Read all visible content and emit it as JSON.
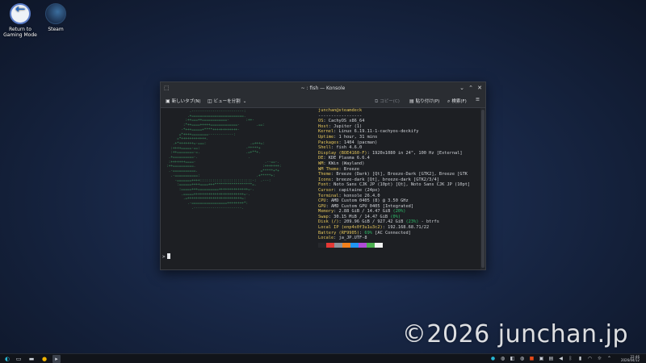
{
  "desktop": {
    "icons": [
      {
        "label": "Return to Gaming Mode"
      },
      {
        "label": "Steam"
      }
    ]
  },
  "window": {
    "title": "~ : fish — Konsole",
    "toolbar": {
      "new_tab": "新しいタブ(N)",
      "split_view": "ビューを分割",
      "copy": "コピー(C)",
      "paste": "貼り付け(P)",
      "find": "検索(F)"
    }
  },
  "terminal": {
    "ascii_art": [
      "             .-------------------------:",
      "            .+=========================.",
      "           :++===++============-        :++-",
      "          :*++====+++++=============-        .==:",
      "         -*+++=====+****++++++++++++-",
      "        =*++++========------------:",
      "       =*++++++++++++.",
      "     .+*+++++++=-===:                     .=+++=:",
      "    :++++=====-==:                      -*****+",
      "    :++========-=.                      .=+**+.",
      "   .+==========-.                        .",
      "   :+++++++====-                                 .--==-.",
      "  :++==========.                                :+++++++:",
      "   .-===========.                              =*****+*+",
      "    .-===========:                           .+*****+:",
      "      -=======++++:::::::::::::::::::::::::-:  .---:",
      "       :======++++====+++******************=.",
      "        :=====+++==========++++++++++++++=-.",
      "         .=====++++++++++++++++++++++++=-.",
      "          .=++++++++++++++++++++++++++=:",
      "            .-=================++++++++*:",
      "              .-----------------------."
    ],
    "header": "junchan@steamdeck",
    "separator": "-----------------",
    "info": [
      {
        "k": "OS",
        "v": "CachyOS x86_64"
      },
      {
        "k": "Host",
        "v": "Jupiter (1)"
      },
      {
        "k": "Kernel",
        "v": "Linux 6.19.11-1-cachyos-deckify"
      },
      {
        "k": "Uptime",
        "v": "1 hour, 31 mins"
      },
      {
        "k": "Packages",
        "v": "1404 (pacman)"
      },
      {
        "k": "Shell",
        "v": "fish 4.6.0"
      },
      {
        "k": "Display (BOE4160-F)",
        "v": "1920x1080 in 24\", 100 Hz [External]"
      },
      {
        "k": "DE",
        "v": "KDE Plasma 6.6.4"
      },
      {
        "k": "WM",
        "v": "KWin (Wayland)"
      },
      {
        "k": "WM Theme",
        "v": "Breeze"
      },
      {
        "k": "Theme",
        "v": "Breeze (Dark) [Qt], Breeze-Dark [GTK2], Breeze [GTK"
      },
      {
        "k": "Icons",
        "v": "breeze-dark [Qt], breeze-dark [GTK2/3/4]"
      },
      {
        "k": "Font",
        "v": "Noto Sans CJK JP (10pt) [Qt], Noto Sans CJK JP (10pt]"
      },
      {
        "k": "Cursor",
        "v": "capitaine (24px)"
      },
      {
        "k": "Terminal",
        "v": "konsole 26.4.0"
      },
      {
        "k": "CPU",
        "v": "AMD Custom 0405 (8) @ 3.50 GHz"
      },
      {
        "k": "GPU",
        "v": "AMD Custom GPU 0405 [Integrated]"
      },
      {
        "k": "Memory",
        "v": "2.88 GiB / 14.47 GiB",
        "pct": "(20%)"
      },
      {
        "k": "Swap",
        "v": "30.15 MiB / 14.47 GiB",
        "pct": "(0%)"
      },
      {
        "k": "Disk (/)",
        "v": "209.96 GiB / 927.42 GiB",
        "pct": "(23%)",
        "tail": " - btrfs"
      },
      {
        "k": "Local IP (enp4s0f3u1u3c2)",
        "v": "192.168.68.71/22"
      },
      {
        "k": "Battery (RF9905)",
        "v": "",
        "pct": "69%",
        "tail": " [AC Connected]"
      },
      {
        "k": "Locale",
        "v": "ja_JP.UTF-8"
      }
    ],
    "palette": [
      "#26282c",
      "#e53935",
      "#8d939b",
      "#f2811d",
      "#2196f3",
      "#b04dd8",
      "#4caf50",
      "#f2f2f2"
    ],
    "prompt": ">"
  },
  "watermark": "©2026 junchan.jp",
  "clock": {
    "time": "22:46",
    "date": "2026/04/12"
  }
}
